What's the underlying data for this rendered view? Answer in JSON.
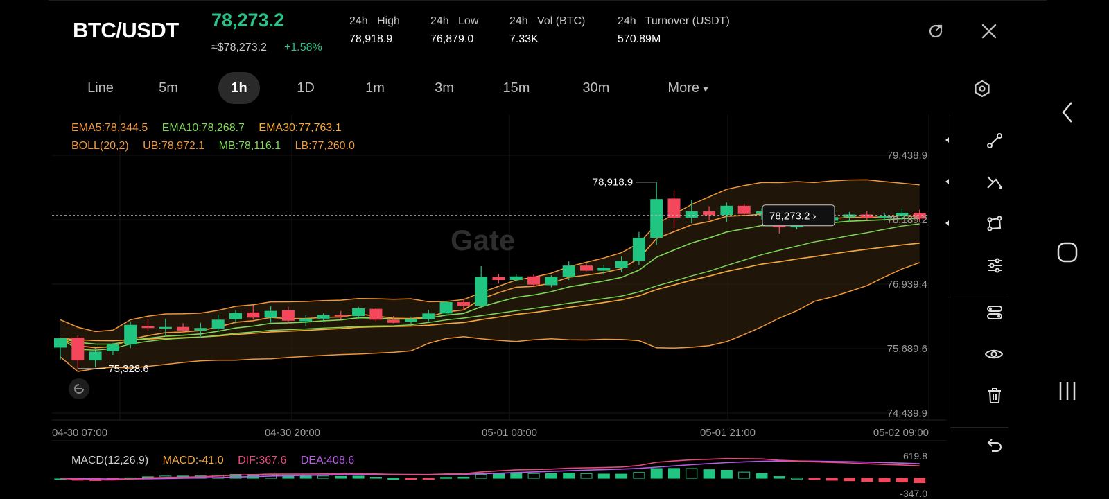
{
  "header": {
    "pair": "BTC/USDT",
    "last_price": "78,273.2",
    "approx_price": "≈$78,273.2",
    "change_pct": "+1.58%",
    "stats": [
      {
        "label": "24h   High",
        "value": "78,918.9"
      },
      {
        "label": "24h   Low",
        "value": "76,879.0"
      },
      {
        "label": "24h   Vol (BTC)",
        "value": "7.33K"
      },
      {
        "label": "24h   Turnover (USDT)",
        "value": "570.89M"
      }
    ],
    "icons": [
      "refresh-share-icon",
      "close-icon"
    ]
  },
  "timeframes": {
    "items": [
      "Line",
      "5m",
      "1h",
      "1D",
      "1m",
      "3m",
      "15m",
      "30m",
      "More"
    ],
    "active": "1h",
    "more_caret": "▾"
  },
  "indicators": {
    "ema": [
      {
        "label": "EMA5:78,344.5",
        "color": "#f0983a"
      },
      {
        "label": "EMA10:78,268.7",
        "color": "#7ed957"
      },
      {
        "label": "EMA30:77,763.1",
        "color": "#f7a93a"
      }
    ],
    "boll": [
      {
        "label": "BOLL(20,2)",
        "color": "#f0983a"
      },
      {
        "label": "UB:78,972.1",
        "color": "#f0983a"
      },
      {
        "label": "MB:78,116.1",
        "color": "#7ed957"
      },
      {
        "label": "LB:77,260.0",
        "color": "#f0983a"
      }
    ],
    "macd": [
      {
        "label": "MACD(12,26,9)",
        "color": "#cfcfcf"
      },
      {
        "label": "MACD:-41.0",
        "color": "#f7a93a"
      },
      {
        "label": "DIF:367.6",
        "color": "#e84a7f"
      },
      {
        "label": "DEA:408.6",
        "color": "#b95ce6"
      }
    ]
  },
  "chart_data": {
    "type": "candlestick",
    "price_axis_ticks": [
      "79,438.9",
      "78,189.2",
      "76,939.4",
      "75,689.6",
      "74,439.9"
    ],
    "ylim": [
      74439.9,
      79438.9
    ],
    "time_axis_ticks": [
      "04-30 07:00",
      "04-30 20:00",
      "05-01 08:00",
      "05-01 21:00",
      "05-02 09:00"
    ],
    "high_label": "78,918.9",
    "low_label": "75,328.6",
    "last_price_label": "78,273.2",
    "watermark": "Gate",
    "candles": [
      {
        "o": 75710,
        "h": 75830,
        "l": 75470,
        "c": 75890
      },
      {
        "o": 75900,
        "h": 75950,
        "l": 75300,
        "c": 75460
      },
      {
        "o": 75460,
        "h": 75700,
        "l": 75329,
        "c": 75630
      },
      {
        "o": 75640,
        "h": 75800,
        "l": 75570,
        "c": 75770
      },
      {
        "o": 75770,
        "h": 76220,
        "l": 75700,
        "c": 76150
      },
      {
        "o": 76130,
        "h": 76260,
        "l": 76030,
        "c": 76090
      },
      {
        "o": 76080,
        "h": 76270,
        "l": 75950,
        "c": 76110
      },
      {
        "o": 76110,
        "h": 76180,
        "l": 75990,
        "c": 76040
      },
      {
        "o": 76040,
        "h": 76190,
        "l": 75900,
        "c": 76090
      },
      {
        "o": 76080,
        "h": 76350,
        "l": 76020,
        "c": 76250
      },
      {
        "o": 76260,
        "h": 76440,
        "l": 76180,
        "c": 76380
      },
      {
        "o": 76390,
        "h": 76530,
        "l": 76260,
        "c": 76290
      },
      {
        "o": 76290,
        "h": 76510,
        "l": 76170,
        "c": 76420
      },
      {
        "o": 76430,
        "h": 76500,
        "l": 76180,
        "c": 76230
      },
      {
        "o": 76220,
        "h": 76330,
        "l": 76130,
        "c": 76270
      },
      {
        "o": 76270,
        "h": 76370,
        "l": 76200,
        "c": 76340
      },
      {
        "o": 76340,
        "h": 76420,
        "l": 76250,
        "c": 76320
      },
      {
        "o": 76320,
        "h": 76500,
        "l": 76260,
        "c": 76470
      },
      {
        "o": 76460,
        "h": 76480,
        "l": 76210,
        "c": 76250
      },
      {
        "o": 76250,
        "h": 76320,
        "l": 76180,
        "c": 76190
      },
      {
        "o": 76210,
        "h": 76310,
        "l": 76170,
        "c": 76260
      },
      {
        "o": 76260,
        "h": 76440,
        "l": 76220,
        "c": 76370
      },
      {
        "o": 76370,
        "h": 76620,
        "l": 76330,
        "c": 76590
      },
      {
        "o": 76590,
        "h": 76660,
        "l": 76440,
        "c": 76520
      },
      {
        "o": 76520,
        "h": 77290,
        "l": 76470,
        "c": 77080
      },
      {
        "o": 77080,
        "h": 77140,
        "l": 76950,
        "c": 77020
      },
      {
        "o": 77020,
        "h": 77140,
        "l": 76990,
        "c": 77090
      },
      {
        "o": 77090,
        "h": 77130,
        "l": 76890,
        "c": 76930
      },
      {
        "o": 76920,
        "h": 77110,
        "l": 76880,
        "c": 77080
      },
      {
        "o": 77080,
        "h": 77380,
        "l": 77020,
        "c": 77300
      },
      {
        "o": 77300,
        "h": 77340,
        "l": 77190,
        "c": 77200
      },
      {
        "o": 77200,
        "h": 77310,
        "l": 77120,
        "c": 77260
      },
      {
        "o": 77260,
        "h": 77480,
        "l": 77170,
        "c": 77390
      },
      {
        "o": 77390,
        "h": 77950,
        "l": 77310,
        "c": 77840
      },
      {
        "o": 77840,
        "h": 78919,
        "l": 77700,
        "c": 78590
      },
      {
        "o": 78600,
        "h": 78760,
        "l": 78030,
        "c": 78230
      },
      {
        "o": 78230,
        "h": 78580,
        "l": 78120,
        "c": 78350
      },
      {
        "o": 78350,
        "h": 78450,
        "l": 78180,
        "c": 78280
      },
      {
        "o": 78280,
        "h": 78520,
        "l": 78150,
        "c": 78460
      },
      {
        "o": 78460,
        "h": 78500,
        "l": 78280,
        "c": 78300
      },
      {
        "o": 78300,
        "h": 78410,
        "l": 78190,
        "c": 78350
      },
      {
        "o": 78350,
        "h": 78380,
        "l": 77920,
        "c": 78040
      },
      {
        "o": 78040,
        "h": 78250,
        "l": 78000,
        "c": 78200
      },
      {
        "o": 78200,
        "h": 78300,
        "l": 78090,
        "c": 78170
      },
      {
        "o": 78170,
        "h": 78280,
        "l": 78090,
        "c": 78240
      },
      {
        "o": 78240,
        "h": 78340,
        "l": 78150,
        "c": 78290
      },
      {
        "o": 78290,
        "h": 78360,
        "l": 78180,
        "c": 78230
      },
      {
        "o": 78230,
        "h": 78310,
        "l": 78170,
        "c": 78260
      },
      {
        "o": 78260,
        "h": 78400,
        "l": 78190,
        "c": 78320
      },
      {
        "o": 78320,
        "h": 78380,
        "l": 78150,
        "c": 78210
      }
    ],
    "colors": {
      "up": "#20c582",
      "down": "#f4475b",
      "ema5": "#f0983a",
      "ema10": "#7ed957",
      "ema30": "#f7a93a",
      "boll": "#f0983a",
      "band_fill": "#2a1d0c",
      "dif": "#e84a7f",
      "dea": "#b95ce6"
    },
    "macd_axis_ticks": [
      "619.8",
      "-347.0"
    ]
  },
  "toolbar": {
    "icons": [
      "trendline-tool-icon",
      "crossed-lines-tool-icon",
      "shape-tool-icon",
      "indicator-settings-icon",
      "template-icon",
      "visibility-icon",
      "delete-icon",
      "undo-icon"
    ]
  },
  "settings_icon": "settings-hex-icon",
  "system_nav": [
    "back-arrow-icon",
    "home-icon",
    "recents-icon"
  ]
}
